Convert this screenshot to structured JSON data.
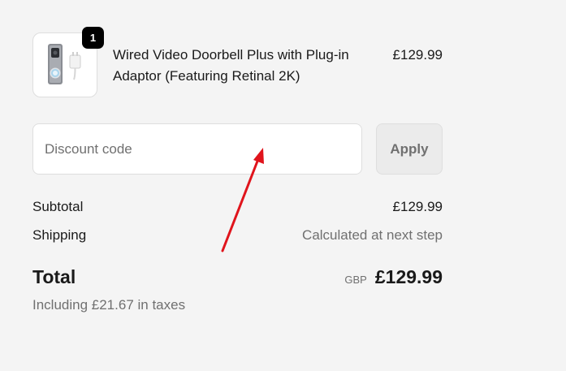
{
  "line_item": {
    "name": "Wired Video Doorbell Plus with Plug-in Adaptor (Featuring Retinal 2K)",
    "price": "£129.99",
    "quantity": "1",
    "image_icon": "doorbell-product-image"
  },
  "discount": {
    "placeholder": "Discount code",
    "value": "",
    "apply_label": "Apply"
  },
  "summary": {
    "subtotal_label": "Subtotal",
    "subtotal_value": "£129.99",
    "shipping_label": "Shipping",
    "shipping_value": "Calculated at next step"
  },
  "total": {
    "label": "Total",
    "currency": "GBP",
    "amount": "£129.99",
    "tax_note": "Including £21.67 in taxes"
  },
  "colors": {
    "background": "#f4f4f4",
    "badge": "#000000",
    "muted_text": "#707070",
    "annotation_arrow": "#e0141c"
  }
}
